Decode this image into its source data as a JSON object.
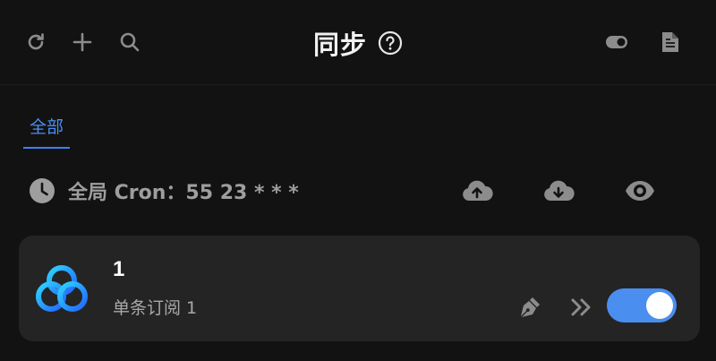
{
  "header": {
    "title": "同步",
    "icons": {
      "refresh": "refresh-icon",
      "add": "plus-icon",
      "search": "search-icon",
      "help": "question-circle-icon",
      "toggle": "toggle-icon",
      "file": "file-icon"
    }
  },
  "tabs": [
    {
      "label": "全部",
      "active": true
    }
  ],
  "cron": {
    "text": "全局 Cron：55 23 * * *"
  },
  "actions": [
    "cloud-upload-icon",
    "cloud-download-icon",
    "eye-icon"
  ],
  "subscriptions": [
    {
      "title": "1",
      "subtitle": "单条订阅 1",
      "enabled": true
    }
  ],
  "colors": {
    "background": "#121212",
    "card": "#242424",
    "accent": "#4a8ef0",
    "icon": "#8c8c8c"
  }
}
